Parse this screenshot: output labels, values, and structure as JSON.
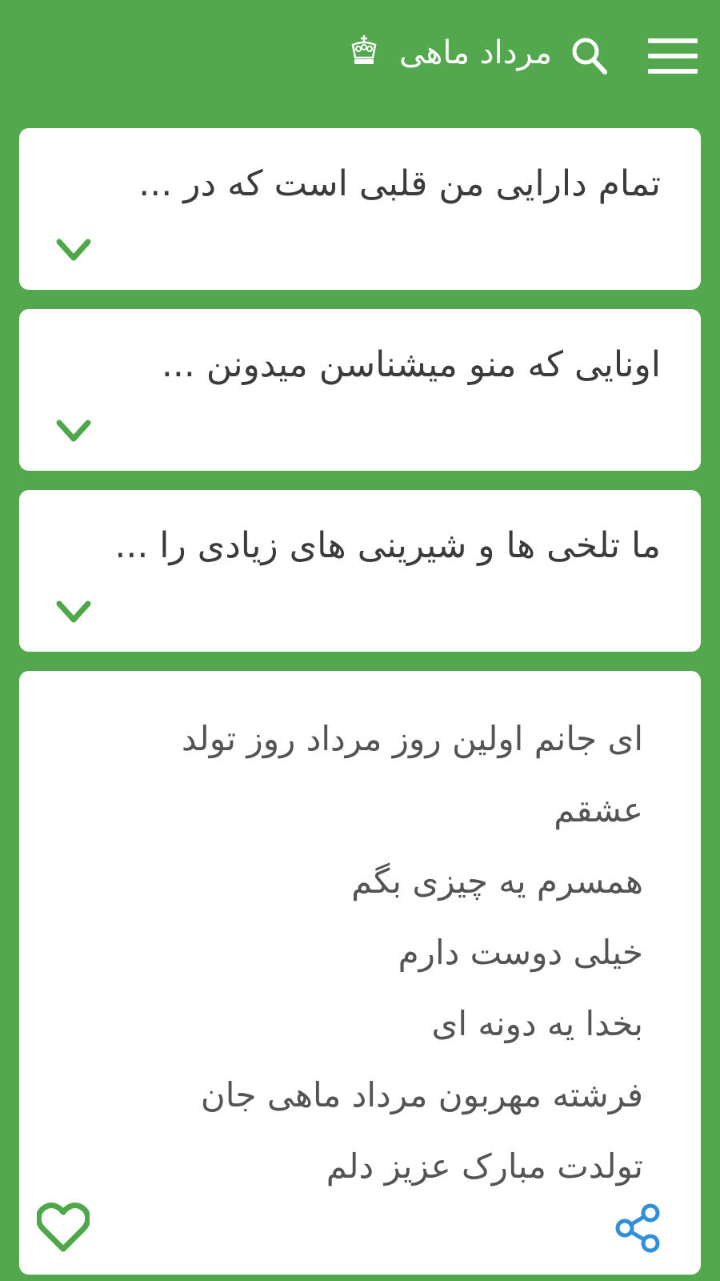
{
  "app": {
    "title": "مرداد ماهی",
    "accent_color": "#53a84e",
    "icons": {
      "menu": "menu-icon",
      "search": "search-icon",
      "crown": "crown-icon",
      "expand": "chevron-down-icon",
      "favorite": "heart-icon",
      "share": "share-icon"
    }
  },
  "cards": [
    {
      "title": "تمام دارایی من قلبی است که در ..."
    },
    {
      "title": "اونایی که منو میشناسن میدونن ..."
    },
    {
      "title": "ما تلخی ها و شیرینی های زیادی را ..."
    }
  ],
  "expanded_card": {
    "lines": [
      "ای جانم اولین روز مرداد روز تولد",
      "عشقم",
      "همسرم یه چیزی بگم",
      "خیلی دوست دارم",
      "بخدا یه دونه ای",
      "فرشته مهربون مرداد ماهی جان",
      "تولدت مبارک عزیز دلم"
    ]
  }
}
